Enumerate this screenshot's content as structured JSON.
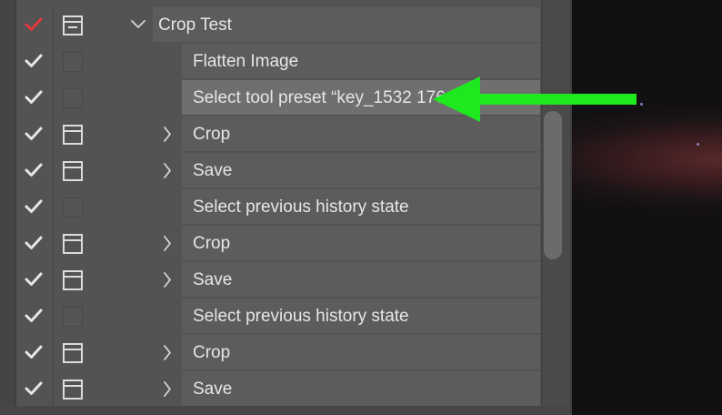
{
  "actions_panel": {
    "rows": [
      {
        "label": "Crop Test",
        "checked": true,
        "check_color": "#e0383a",
        "dialog": "minus",
        "expand": "open",
        "indent": 0,
        "selected": false
      },
      {
        "label": "Flatten Image",
        "checked": true,
        "check_color": "#e6e6e6",
        "dialog": "empty",
        "expand": "none",
        "indent": 1,
        "selected": false
      },
      {
        "label": "Select tool preset “key_1532   176 p",
        "checked": true,
        "check_color": "#e6e6e6",
        "dialog": "empty",
        "expand": "none",
        "indent": 1,
        "selected": true
      },
      {
        "label": "Crop",
        "checked": true,
        "check_color": "#e6e6e6",
        "dialog": "on",
        "expand": "closed",
        "indent": 1,
        "selected": false
      },
      {
        "label": "Save",
        "checked": true,
        "check_color": "#e6e6e6",
        "dialog": "on",
        "expand": "closed",
        "indent": 1,
        "selected": false
      },
      {
        "label": "Select previous history state",
        "checked": true,
        "check_color": "#e6e6e6",
        "dialog": "empty",
        "expand": "none",
        "indent": 1,
        "selected": false
      },
      {
        "label": "Crop",
        "checked": true,
        "check_color": "#e6e6e6",
        "dialog": "on",
        "expand": "closed",
        "indent": 1,
        "selected": false
      },
      {
        "label": "Save",
        "checked": true,
        "check_color": "#e6e6e6",
        "dialog": "on",
        "expand": "closed",
        "indent": 1,
        "selected": false
      },
      {
        "label": "Select previous history state",
        "checked": true,
        "check_color": "#e6e6e6",
        "dialog": "empty",
        "expand": "none",
        "indent": 1,
        "selected": false
      },
      {
        "label": "Crop",
        "checked": true,
        "check_color": "#e6e6e6",
        "dialog": "on",
        "expand": "closed",
        "indent": 1,
        "selected": false
      },
      {
        "label": "Save",
        "checked": true,
        "check_color": "#e6e6e6",
        "dialog": "on",
        "expand": "closed",
        "indent": 1,
        "selected": false
      }
    ]
  },
  "annotation": {
    "icon": "arrow-left-icon",
    "color": "#1ee81e"
  },
  "colors": {
    "panel": "#535353",
    "row": "#5c5c5c",
    "selected_row": "#6f6f6f",
    "text": "#e6e6e6"
  }
}
